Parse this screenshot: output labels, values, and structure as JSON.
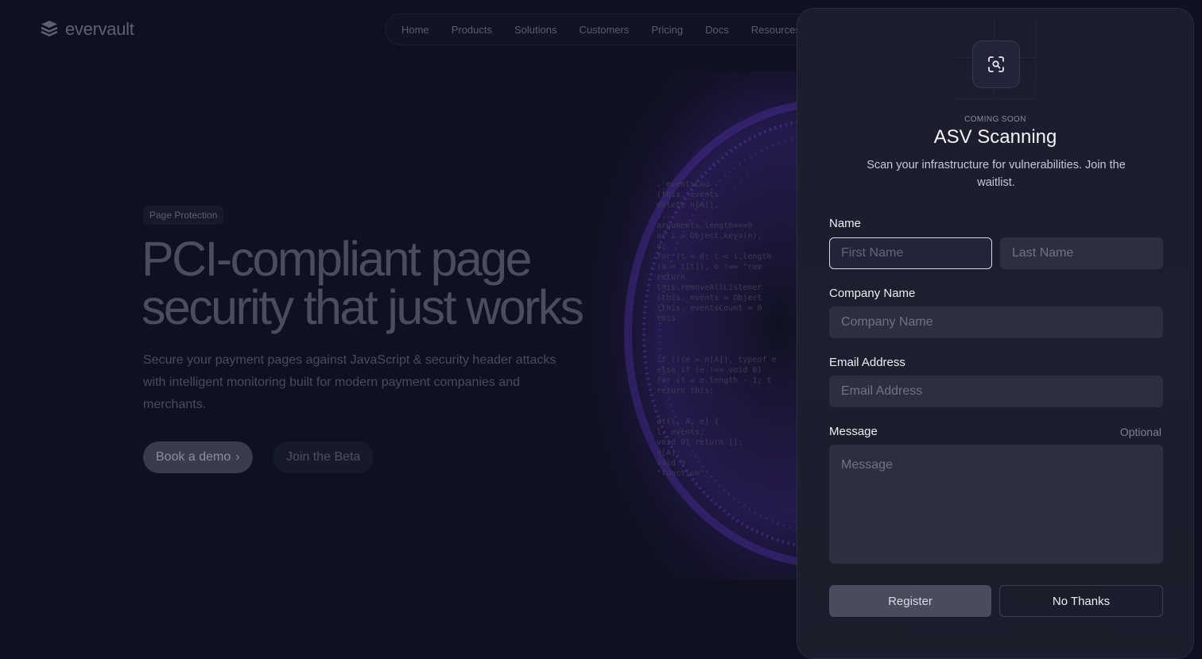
{
  "brand": {
    "name": "evervault"
  },
  "nav": {
    "items": [
      {
        "label": "Home"
      },
      {
        "label": "Products"
      },
      {
        "label": "Solutions"
      },
      {
        "label": "Customers"
      },
      {
        "label": "Pricing"
      },
      {
        "label": "Docs"
      },
      {
        "label": "Resources"
      }
    ]
  },
  "hero": {
    "badge": "Page Protection",
    "title_line1": "PCI-compliant page",
    "title_line2": "security that just works",
    "subtitle": "Secure your payment pages against JavaScript & security header attacks with intelligent monitoring built for modern payment companies and merchants.",
    "primary_cta": "Book a demo",
    "secondary_cta": "Join the Beta"
  },
  "code_lines": [
    "  ._eventsCou",
    "  (this._events",
    " delete n[A]),",
    " ...",
    "arguments.length===0",
    "ar i = Object.keys(n),",
    "o;",
    "for (t = 0; t < i.length",
    "(o = i[t]), o !== \"rem",
    "return",
    "this.removeAllListener",
    "(this._events = Object",
    "(this._eventsCount = 0",
    "this",
    "",
    "",
    "",
    "if (((e = n[A]), typeof e",
    "else if (e !== void 0)",
    "for (t = e.length - 1; t",
    "return this;",
    "",
    "",
    "dt(l, A, e) {",
    "l._events;",
    "void 0) return [];",
    "n[A];",
    "void 0",
    "\"function\""
  ],
  "modal": {
    "eyebrow": "COMING SOON",
    "title": "ASV Scanning",
    "description": "Scan your infrastructure for vulnerabilities. Join the waitlist.",
    "name_label": "Name",
    "first_name_placeholder": "First Name",
    "last_name_placeholder": "Last Name",
    "company_label": "Company Name",
    "company_placeholder": "Company Name",
    "email_label": "Email Address",
    "email_placeholder": "Email Address",
    "message_label": "Message",
    "message_optional": "Optional",
    "message_placeholder": "Message",
    "register_label": "Register",
    "no_thanks_label": "No Thanks"
  },
  "colors": {
    "background": "#0f1120",
    "panel": "#1c1e2e",
    "swirl_accent": "#6d3fd6"
  }
}
